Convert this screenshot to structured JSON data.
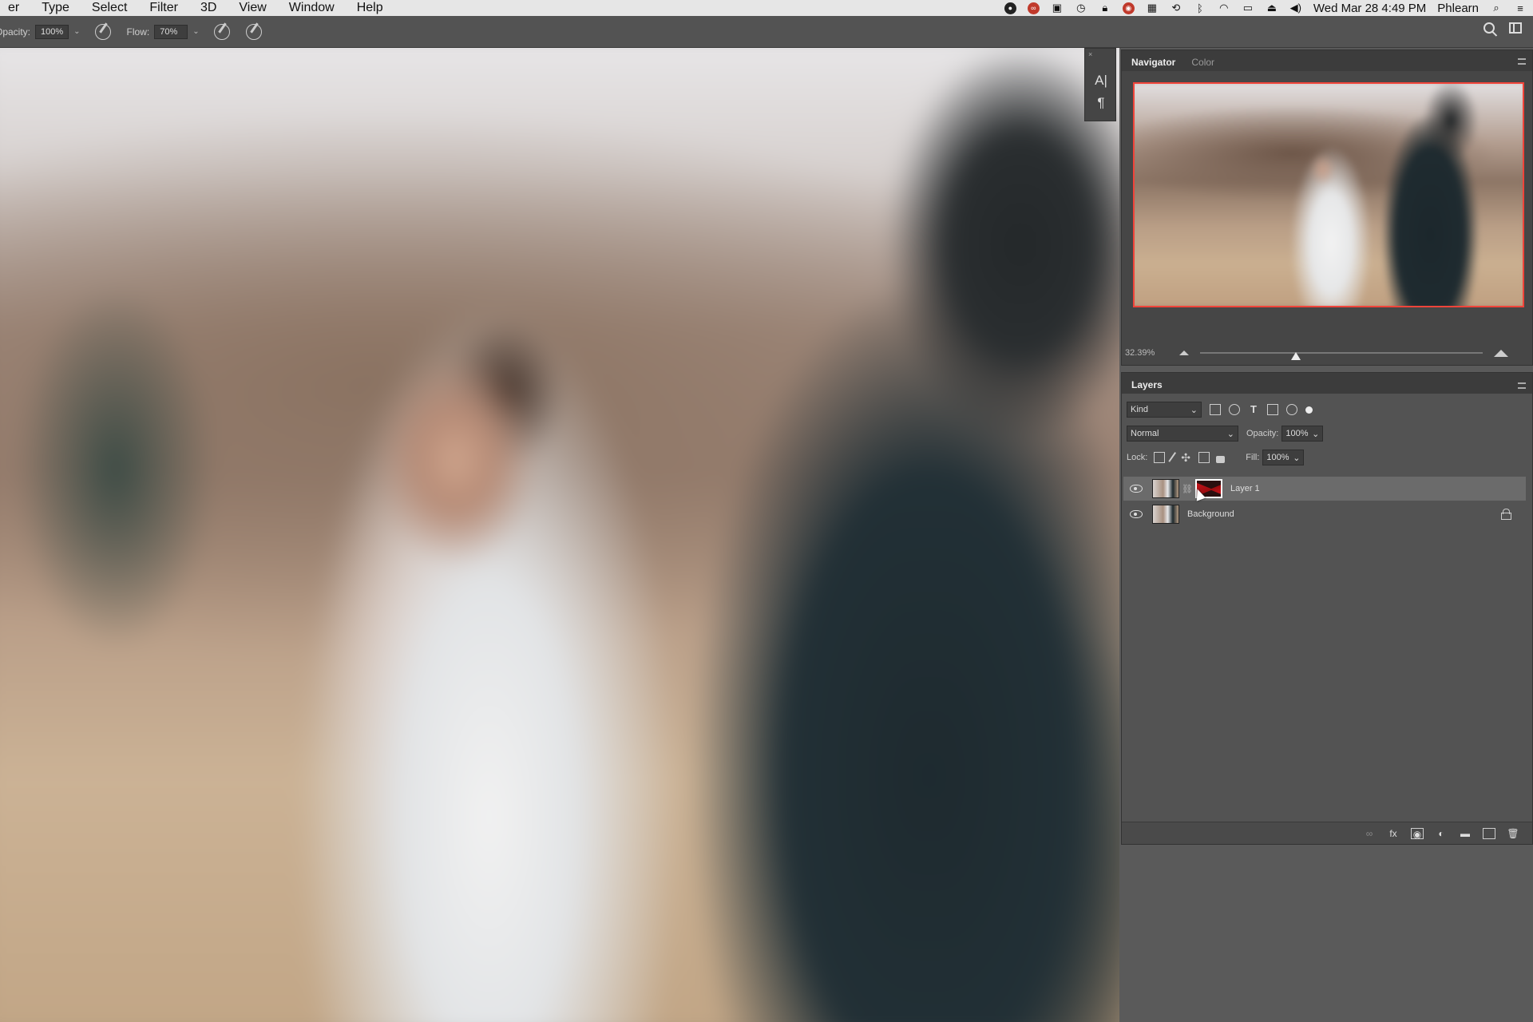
{
  "menubar": {
    "items": [
      "er",
      "Type",
      "Select",
      "Filter",
      "3D",
      "View",
      "Window",
      "Help"
    ],
    "clock": "Wed Mar 28  4:49 PM",
    "user": "Phlearn",
    "status_icons": [
      "app-icon",
      "creative-cloud-icon",
      "screen-share-icon",
      "time-machine-icon",
      "lock-icon",
      "app-icon",
      "grid-icon",
      "history-icon",
      "bluetooth-icon",
      "wifi-icon",
      "display-icon",
      "eject-icon",
      "volume-icon",
      "spotlight-icon",
      "notification-icon"
    ]
  },
  "options_bar": {
    "opacity_label": "Opacity:",
    "opacity_value": "100%",
    "flow_label": "Flow:",
    "flow_value": "70%"
  },
  "navigator": {
    "tabs": [
      "Navigator",
      "Color"
    ],
    "zoom": "32.39%",
    "zoom_slider_fraction": 0.34
  },
  "tool_strip": {
    "icons": [
      "character-icon",
      "paragraph-icon"
    ]
  },
  "layers": {
    "tab": "Layers",
    "filter_kind": "Kind",
    "blend_mode": "Normal",
    "opacity_label": "Opacity:",
    "opacity_value": "100%",
    "lock_label": "Lock:",
    "fill_label": "Fill:",
    "fill_value": "100%",
    "rows": [
      {
        "name": "Layer 1",
        "selected": true,
        "has_mask": true
      },
      {
        "name": "Background",
        "selected": false,
        "locked": true
      }
    ],
    "footer_icons": [
      "link-icon",
      "fx-icon",
      "add-mask-icon",
      "adjustment-icon",
      "folder-icon",
      "new-layer-icon",
      "trash-icon"
    ]
  }
}
